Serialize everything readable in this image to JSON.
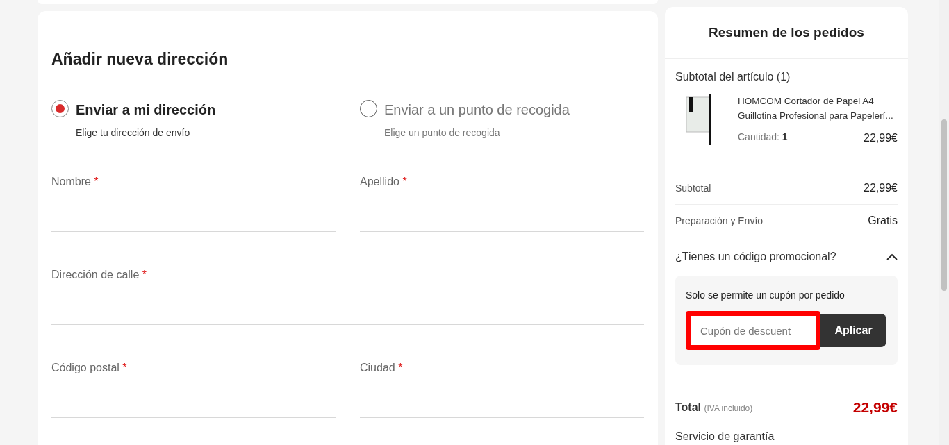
{
  "address_form": {
    "title": "Añadir nueva dirección",
    "delivery_options": [
      {
        "label": "Enviar a mi dirección",
        "hint": "Elige tu dirección de envío",
        "selected": true
      },
      {
        "label": "Enviar a un punto de recogida",
        "hint": "Elige un punto de recogida",
        "selected": false
      }
    ],
    "field_rows": [
      [
        {
          "label": "Nombre",
          "required": "*"
        },
        {
          "label": "Apellido",
          "required": "*"
        }
      ],
      [
        {
          "label": "Dirección de calle",
          "required": "*"
        }
      ],
      [
        {
          "label": "Código postal",
          "required": "*"
        },
        {
          "label": "Ciudad",
          "required": "*"
        }
      ]
    ]
  },
  "order_summary": {
    "title": "Resumen de los pedidos",
    "items_heading": "Subtotal del artículo (1)",
    "items": [
      {
        "name": "HOMCOM Cortador de Papel A4 Guillotina Profesional para Papelerí...",
        "quantity_label": "Cantidad:",
        "quantity": "1",
        "price": "22,99€"
      }
    ],
    "lines": [
      {
        "label": "Subtotal",
        "value": "22,99€"
      },
      {
        "label": "Preparación y Envío",
        "value": "Gratis"
      }
    ],
    "promo": {
      "question": "¿Tienes un código promocional?",
      "expanded": true,
      "note": "Solo se permite un cupón por pedido",
      "placeholder": "Cupón de descuent",
      "highlighted": true,
      "button": "Aplicar"
    },
    "total": {
      "label": "Total",
      "note": "(IVA incluido)",
      "value": "22,99€"
    },
    "warranty_heading": "Servicio de garantía"
  }
}
